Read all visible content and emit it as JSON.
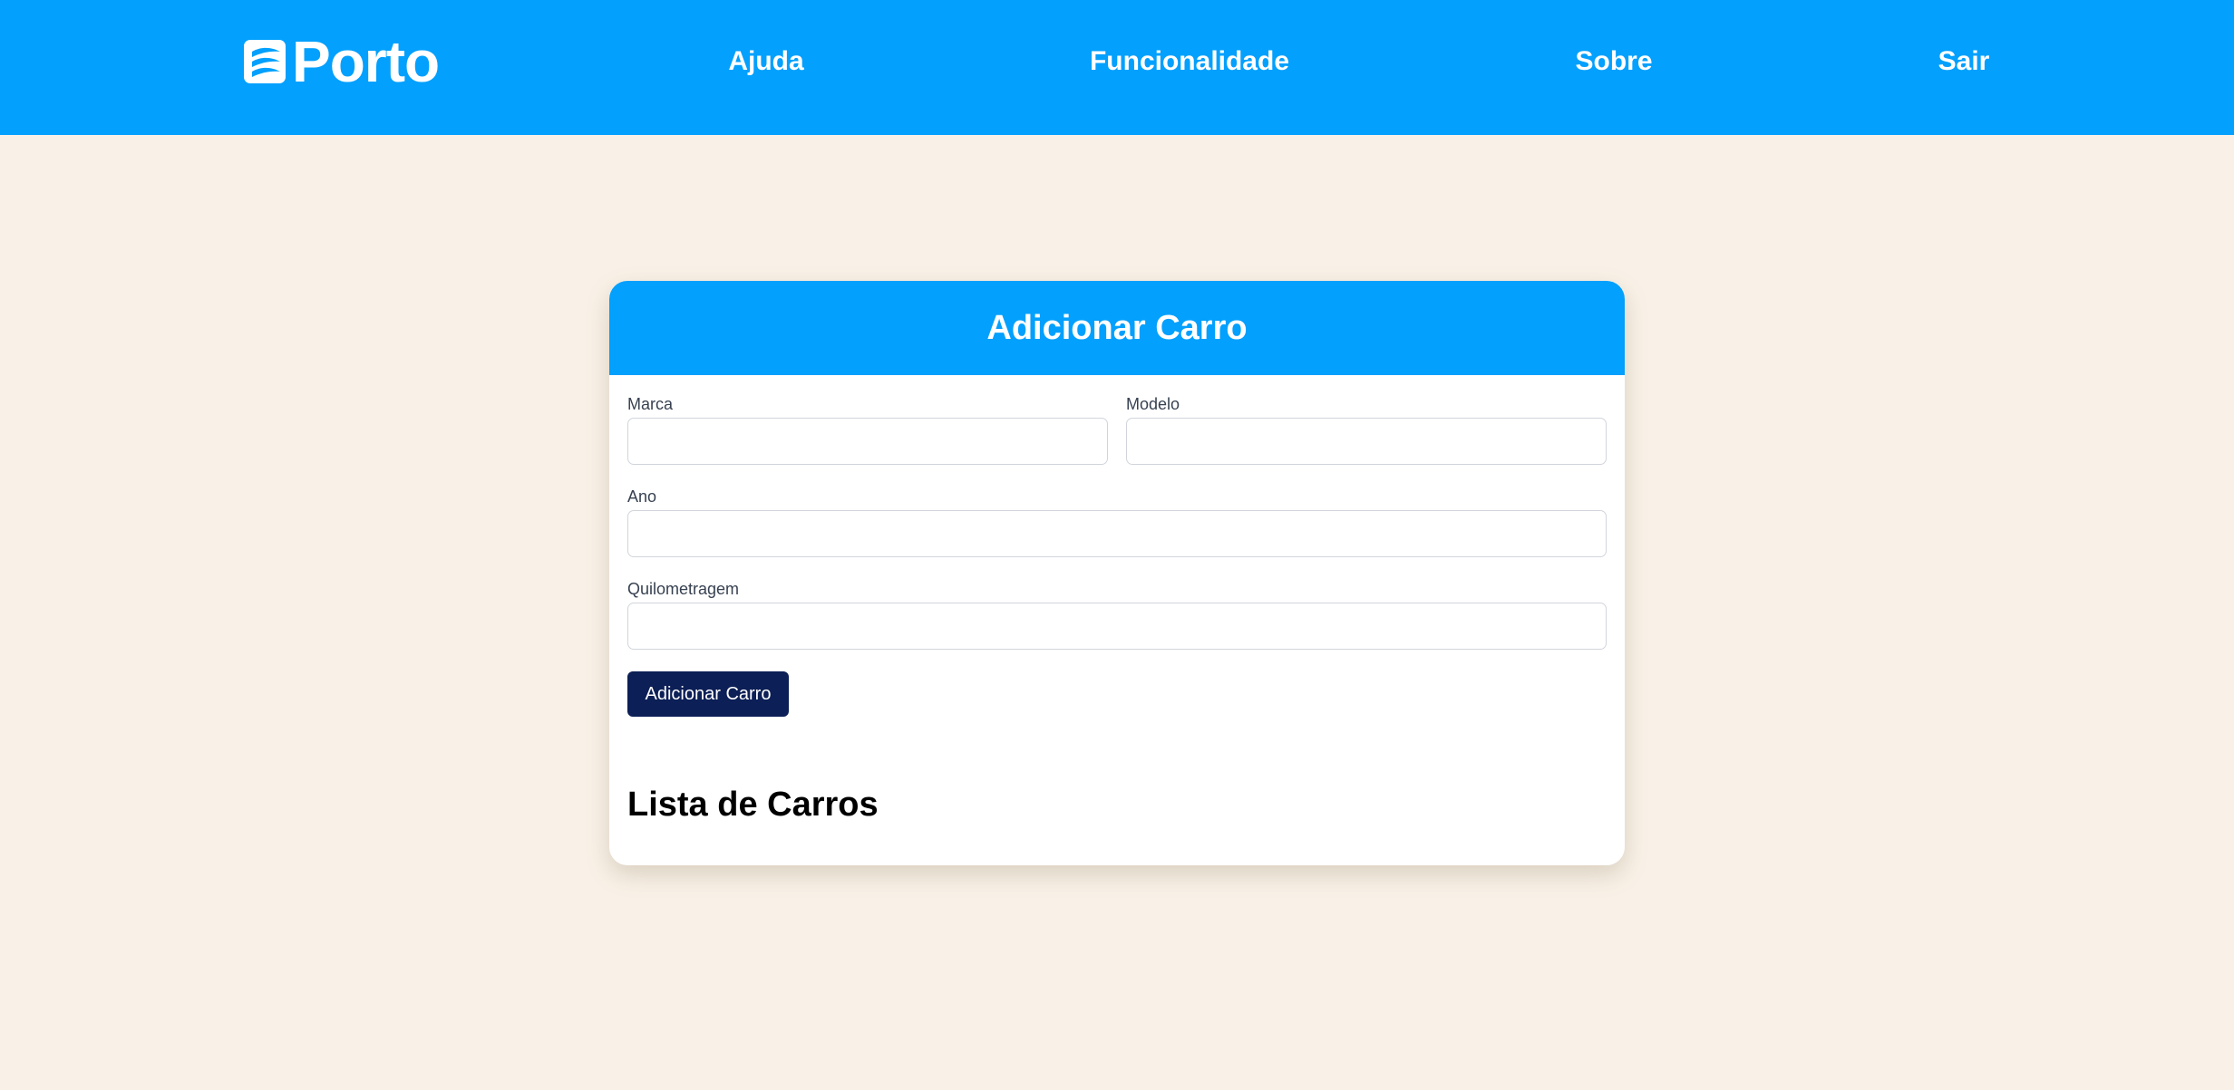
{
  "header": {
    "logo_text": "Porto",
    "logo_icon": "porto-sail-icon",
    "nav": [
      {
        "label": "Ajuda"
      },
      {
        "label": "Funcionalidade"
      },
      {
        "label": "Sobre"
      },
      {
        "label": "Sair"
      }
    ]
  },
  "form": {
    "title": "Adicionar Carro",
    "fields": {
      "marca": {
        "label": "Marca",
        "value": ""
      },
      "modelo": {
        "label": "Modelo",
        "value": ""
      },
      "ano": {
        "label": "Ano",
        "value": ""
      },
      "quilometragem": {
        "label": "Quilometragem",
        "value": ""
      }
    },
    "submit_label": "Adicionar Carro"
  },
  "list": {
    "title": "Lista de Carros",
    "items": []
  },
  "colors": {
    "primary_blue": "#03a0fd",
    "button_navy": "#0c1f56",
    "page_background": "#f9f1e7",
    "card_background": "#ffffff"
  }
}
